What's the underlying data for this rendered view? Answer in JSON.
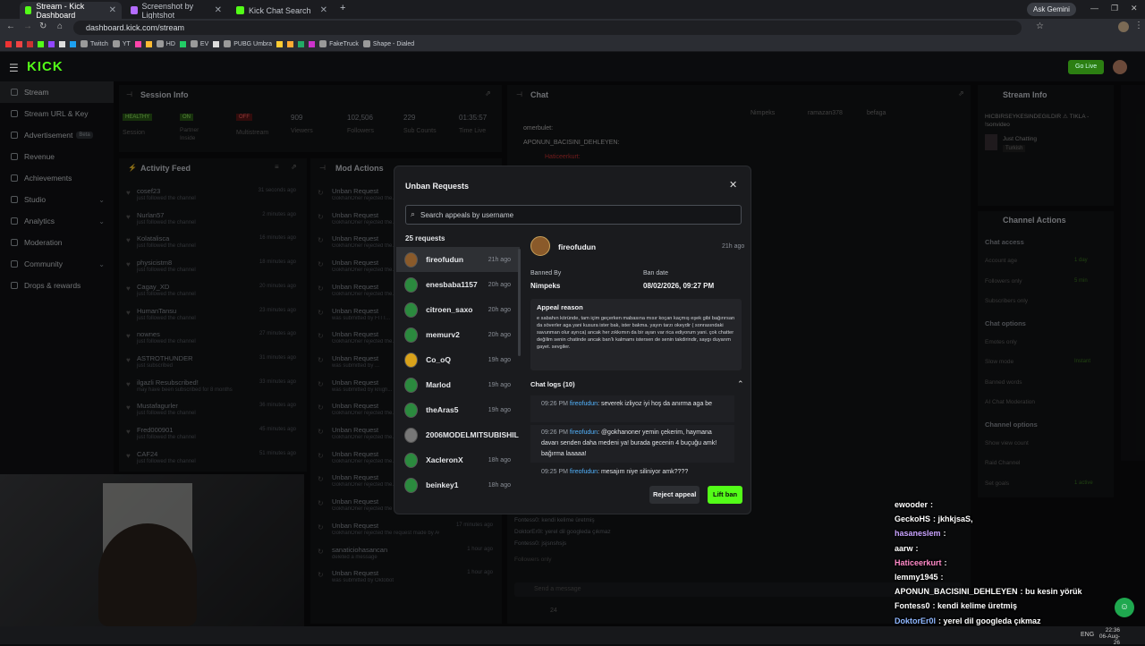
{
  "browser": {
    "tabs": [
      {
        "label": "Stream - Kick Dashboard",
        "color": "#53fc18"
      },
      {
        "label": "Screenshot by Lightshot",
        "color": "#b46cff"
      },
      {
        "label": "Kick Chat Search",
        "color": "#53fc18"
      }
    ],
    "url": "dashboard.kick.com/stream",
    "ask_gemini": "Ask Gemini",
    "bookmarks": [
      "Twitch",
      "YT",
      "HD",
      "EV",
      "PUBG Umbra",
      "FakeTruck",
      "Shape - Dialed"
    ]
  },
  "kick": {
    "logo": "KICK",
    "go_live": "Go Live",
    "sidebar": [
      {
        "label": "Stream",
        "active": true
      },
      {
        "label": "Stream URL & Key"
      },
      {
        "label": "Advertisement",
        "badge": "Beta"
      },
      {
        "label": "Revenue"
      },
      {
        "label": "Achievements"
      },
      {
        "label": "Studio",
        "chevron": true
      },
      {
        "label": "Analytics",
        "chevron": true
      },
      {
        "label": "Moderation"
      },
      {
        "label": "Community",
        "chevron": true
      },
      {
        "label": "Drops & rewards"
      }
    ],
    "session": {
      "title": "Session Info",
      "stats": [
        {
          "badge": "HEALTHY",
          "label": "Session"
        },
        {
          "badge": "ON",
          "label": "Partner Inside"
        },
        {
          "badge": "OFF",
          "label": "Multistream"
        },
        {
          "value": "909",
          "label": "Viewers"
        },
        {
          "value": "102,506",
          "label": "Followers"
        },
        {
          "value": "229",
          "label": "Sub Counts"
        },
        {
          "value": "01:35:57",
          "label": "Time Live"
        }
      ]
    },
    "activity_feed": {
      "title": "Activity Feed",
      "items": [
        {
          "name": "cosef23",
          "sub": "just followed the channel",
          "time": "31 seconds ago"
        },
        {
          "name": "Nurlan57",
          "sub": "just followed the channel",
          "time": "2 minutes ago"
        },
        {
          "name": "Kolatalisca",
          "sub": "just followed the channel",
          "time": "16 minutes ago"
        },
        {
          "name": "physicistm8",
          "sub": "just followed the channel",
          "time": "18 minutes ago"
        },
        {
          "name": "Cagay_XD",
          "sub": "just followed the channel",
          "time": "20 minutes ago"
        },
        {
          "name": "HumanTansu",
          "sub": "just followed the channel",
          "time": "23 minutes ago"
        },
        {
          "name": "nownes",
          "sub": "just followed the channel",
          "time": "27 minutes ago"
        },
        {
          "name": "ASTROTHUNDER",
          "sub": "just subscribed",
          "time": "31 minutes ago"
        },
        {
          "name": "ilgazli Resubscribed!",
          "sub": "may have been subscribed for 8 months",
          "time": "33 minutes ago"
        },
        {
          "name": "Mustafagurler",
          "sub": "just followed the channel",
          "time": "36 minutes ago"
        },
        {
          "name": "Fred000901",
          "sub": "just followed the channel",
          "time": "45 minutes ago"
        },
        {
          "name": "CAF24",
          "sub": "just followed the channel",
          "time": "51 minutes ago"
        }
      ]
    },
    "mod_actions": {
      "title": "Mod Actions",
      "items": [
        {
          "title": "Unban Request",
          "sub": "GokhanOner rejected the..."
        },
        {
          "title": "Unban Request",
          "sub": "GokhanOner rejected the..."
        },
        {
          "title": "Unban Request",
          "sub": "GokhanOner rejected the..."
        },
        {
          "title": "Unban Request",
          "sub": "GokhanOner rejected the..."
        },
        {
          "title": "Unban Request",
          "sub": "GokhanOner rejected the..."
        },
        {
          "title": "Unban Request",
          "sub": "was submitted by FITT..."
        },
        {
          "title": "Unban Request",
          "sub": "GokhanOner rejected the..."
        },
        {
          "title": "Unban Request",
          "sub": "was submitted by ..."
        },
        {
          "title": "Unban Request",
          "sub": "was submitted by knigh..."
        },
        {
          "title": "Unban Request",
          "sub": "GokhanOner rejected the..."
        },
        {
          "title": "Unban Request",
          "sub": "GokhanOner rejected the..."
        },
        {
          "title": "Unban Request",
          "sub": "GokhanOner rejected the..."
        },
        {
          "title": "Unban Request",
          "sub": "GokhanOner rejected the..."
        },
        {
          "title": "Unban Request",
          "sub": "GokhanOner rejected the request made by ktagaton"
        },
        {
          "title": "Unban Request",
          "sub": "GokhanOner rejected the request made by AGPABAP",
          "time": "17 minutes ago"
        },
        {
          "title": "sanaticiohasancan",
          "sub": "deleted a message",
          "time": "1 hour ago"
        },
        {
          "title": "Unban Request",
          "sub": "was submitted by Oktobot",
          "time": "1 hour ago"
        }
      ]
    },
    "chat": {
      "title": "Chat",
      "top_users": [
        "Nimpeks",
        "ramazan378",
        "befaga"
      ],
      "messages": [
        {
          "name": "omerbulet:"
        },
        {
          "name": "APONUN_BACISINI_DEHLEYEN:"
        },
        {
          "name": "Haticeerkurt:"
        }
      ],
      "lower_messages": [
        {
          "name": "Fontess0: kendi kelime üretmiş"
        },
        {
          "name": "DoktorEr0l: yerel dil googleda çıkmaz"
        },
        {
          "name": "Fontess0: jsjsnshsjs"
        }
      ],
      "followers_only": "Followers only",
      "send_placeholder": "Send a message",
      "viewer_count": "24"
    },
    "stream_info": {
      "title": "Stream Info",
      "stream_title": "HICBIRSEYKESINDEGILDIR ⚠ TIKLA - !sonvideo",
      "category": "Just Chatting",
      "language": "Turkish"
    },
    "channel_actions": {
      "title": "Channel Actions",
      "sections": [
        {
          "heading": "Chat access",
          "rows": [
            {
              "label": "Account age",
              "value": "1 day"
            },
            {
              "label": "Followers only",
              "value": "5 min"
            },
            {
              "label": "Subscribers only",
              "value": ""
            }
          ]
        },
        {
          "heading": "Chat options",
          "rows": [
            {
              "label": "Emotes only",
              "value": ""
            },
            {
              "label": "Slow mode",
              "value": "Instant"
            },
            {
              "label": "Banned words",
              "value": ""
            },
            {
              "label": "AI Chat Moderation",
              "value": ""
            }
          ]
        },
        {
          "heading": "Channel options",
          "rows": [
            {
              "label": "Show view count",
              "value": ""
            },
            {
              "label": "Raid Channel",
              "value": ""
            },
            {
              "label": "Set goals",
              "value": "1 active"
            }
          ]
        }
      ]
    }
  },
  "modal": {
    "title": "Unban Requests",
    "search_placeholder": "Search appeals by username",
    "count_label": "25 requests",
    "requests": [
      {
        "user": "fireofudun",
        "time": "21h ago",
        "color": "#8a5a2a"
      },
      {
        "user": "enesbaba1157",
        "time": "20h ago",
        "color": "#2b8a3e"
      },
      {
        "user": "citroen_saxo",
        "time": "20h ago",
        "color": "#2b8a3e"
      },
      {
        "user": "memurv2",
        "time": "20h ago",
        "color": "#2b8a3e"
      },
      {
        "user": "Co_oQ",
        "time": "19h ago",
        "color": "#d9a21a"
      },
      {
        "user": "Marlod",
        "time": "19h ago",
        "color": "#2b8a3e"
      },
      {
        "user": "theAras5",
        "time": "19h ago",
        "color": "#2b8a3e"
      },
      {
        "user": "2006MODELMITSUBISHIL",
        "time": "",
        "color": "#777"
      },
      {
        "user": "XacleronX",
        "time": "18h ago",
        "color": "#2b8a3e"
      },
      {
        "user": "beinkey1",
        "time": "18h ago",
        "color": "#2b8a3e"
      }
    ],
    "detail": {
      "user": "fireofudun",
      "time": "21h ago",
      "banned_by_label": "Banned By",
      "banned_by": "Nimpeks",
      "ban_date_label": "Ban date",
      "ban_date": "08/02/2026, 09:27 PM",
      "appeal_label": "Appeal reason",
      "appeal_text": "e sabahın köründe, tam içim geçerken mabasına mısır koçan kaçmış eşek gibi bağırırsan da söverler aga yani kusura ister bak, ister bakma. yayın tarzı okeydir ( sonrasındaki savunman olur ayrıca) ancak her zıkkımın da bir ayarı var rica ediyorum yani. çok chatter değilim senin chatinde ancak ban'lı kalmamı istersen de senin takdirindir, saygı duyarım gayet. sevgiler.",
      "chat_logs_label": "Chat logs (10)",
      "logs": [
        {
          "time": "09:26 PM",
          "user": "fireofudun",
          "text": ": severek izliyoz iyi hoş da anırma aga be"
        },
        {
          "time": "09:26 PM",
          "user": "fireofudun",
          "text": ": @gokhanoner yemin çekerim, haymana davarı senden daha medeni ya! burada gecenin 4 buçuğu amk! bağırma laaaaa!"
        },
        {
          "time": "09:25 PM",
          "user": "fireofudun",
          "text": ": mesajım niye siliniyor amk????"
        }
      ],
      "reject_label": "Reject appeal",
      "lift_label": "Lift ban"
    }
  },
  "overlay_chat": [
    {
      "name": "ewooder",
      "msg": ":"
    },
    {
      "name": "GeckoHS",
      "msg": ": jkhkjsaS,"
    },
    {
      "name": "hasaneslem",
      "msg": ":"
    },
    {
      "name": "aarw",
      "msg": ":"
    },
    {
      "name": "Haticeerkurt",
      "msg": ":"
    },
    {
      "name": "lemmy1945",
      "msg": ":"
    },
    {
      "name": "APONUN_BACISINI_DEHLEYEN",
      "msg": ": bu kesin yörük"
    },
    {
      "name": "Fontess0",
      "msg": ": kendi kelime üretmiş"
    },
    {
      "name": "DoktorEr0l",
      "msg": ": yerel dil googleda çıkmaz"
    },
    {
      "name": "Fontess0",
      "msg": ": jsjsnshsjs"
    }
  ],
  "taskbar": {
    "lang": "ENG",
    "time": "22:36",
    "date": "06-Aug-26"
  },
  "colors": {
    "accent": "#53fc18",
    "panel": "#131416",
    "modal": "#1a1b1e",
    "link": "#53b4ff"
  }
}
